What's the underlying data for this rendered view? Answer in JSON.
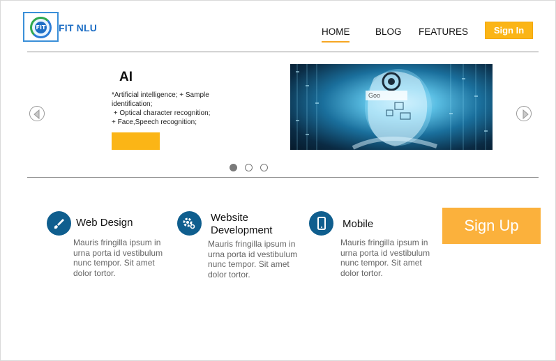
{
  "header": {
    "brand": "FIT NLU",
    "logo_text": "FIT",
    "nav": [
      {
        "label": "HOME",
        "active": true
      },
      {
        "label": "BLOG",
        "active": false
      },
      {
        "label": "FEATURES",
        "active": false
      }
    ],
    "signin_label": "Sign In"
  },
  "slider": {
    "title": "AI",
    "lines": [
      "*Artificial intelligence; + Sample",
      "identification;",
      " + Optical character recognition;",
      "+ Face,Speech recognition;"
    ],
    "button_label": "",
    "dots": [
      true,
      false,
      false
    ],
    "image": "ai-head-image"
  },
  "features": [
    {
      "icon": "brush-icon",
      "title_lines": [
        "Web Design"
      ],
      "description": "Mauris fringilla ipsum in urna porta id vestibulum nunc tempor. Sit amet dolor tortor."
    },
    {
      "icon": "gear-icon",
      "title_lines": [
        "Website",
        "Development"
      ],
      "description": "Mauris fringilla ipsum in urna porta id vestibulum nunc tempor. Sit amet dolor tortor."
    },
    {
      "icon": "mobile-icon",
      "title_lines": [
        "Mobile"
      ],
      "description": "Mauris fringilla ipsum in urna porta id vestibulum nunc tempor. Sit amet dolor tortor."
    }
  ],
  "signup_label": "Sign Up",
  "colors": {
    "accent": "#fbb516",
    "brand_blue": "#1f6fc5",
    "icon_circle": "#0f5e8e",
    "signup": "#fbb13c"
  }
}
